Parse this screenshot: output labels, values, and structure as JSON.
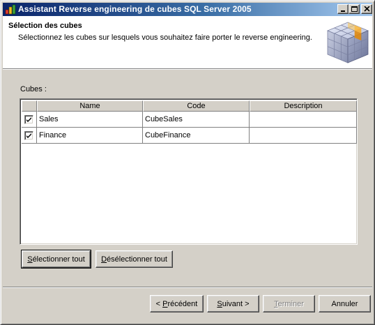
{
  "window": {
    "title": "Assistant Reverse engineering de cubes SQL Server 2005"
  },
  "header": {
    "title": "Sélection des cubes",
    "subtitle": "Sélectionnez les cubes sur lesquels vous souhaitez faire porter le reverse engineering.",
    "image_icon": "olap-cube-icon"
  },
  "cubes": {
    "label": "Cubes :",
    "columns": [
      "",
      "Name",
      "Code",
      "Description"
    ],
    "rows": [
      {
        "checked": true,
        "name": "Sales",
        "code": "CubeSales",
        "description": ""
      },
      {
        "checked": true,
        "name": "Finance",
        "code": "CubeFinance",
        "description": ""
      }
    ]
  },
  "selection_buttons": {
    "select_all": {
      "pre": "",
      "accel": "S",
      "post": "électionner tout"
    },
    "deselect_all": {
      "pre": "",
      "accel": "D",
      "post": "ésélectionner tout"
    }
  },
  "nav_buttons": {
    "back": {
      "pre": "< ",
      "accel": "P",
      "post": "récédent"
    },
    "next": {
      "pre": "",
      "accel": "S",
      "post": "uivant >"
    },
    "finish": {
      "pre": "",
      "accel": "T",
      "post": "erminer"
    },
    "cancel": {
      "pre": "",
      "accel": "",
      "post": "Annuler"
    }
  },
  "colors": {
    "titlebar_start": "#0a246a",
    "titlebar_end": "#a6caf0",
    "face": "#d4d0c8",
    "cube_highlight": "#f0a830"
  }
}
